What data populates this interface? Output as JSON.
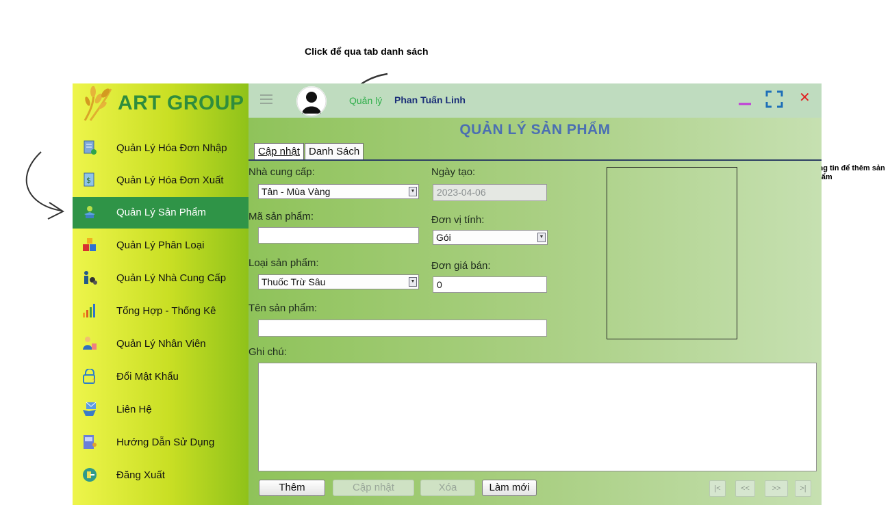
{
  "annotations": {
    "tab_hint": "Click để qua tab danh sách",
    "fill_hint": "Nhập đầy đủ thông tin để thêm sản phẩm"
  },
  "sidebar": {
    "brand": "ART GROUP",
    "active_index": 2,
    "items": [
      {
        "label": "Quản Lý Hóa Đơn Nhập",
        "icon": "invoice-import-icon"
      },
      {
        "label": "Quản Lý Hóa Đơn Xuất",
        "icon": "invoice-export-icon"
      },
      {
        "label": "Quản Lý Sản Phẩm",
        "icon": "product-icon"
      },
      {
        "label": "Quản Lý Phân Loại",
        "icon": "category-icon"
      },
      {
        "label": "Quản Lý Nhà Cung Cấp",
        "icon": "supplier-icon"
      },
      {
        "label": "Tổng Hợp - Thống Kê",
        "icon": "statistics-icon"
      },
      {
        "label": "Quản Lý Nhân Viên",
        "icon": "employee-icon"
      },
      {
        "label": "Đổi Mật Khẩu",
        "icon": "lock-icon"
      },
      {
        "label": "Liên Hệ",
        "icon": "contact-icon"
      },
      {
        "label": "Hướng Dẫn Sử Dụng",
        "icon": "manual-icon"
      },
      {
        "label": "Đăng Xuất",
        "icon": "logout-icon"
      }
    ]
  },
  "header": {
    "role": "Quản lý",
    "username": "Phan Tuấn Linh",
    "page_title": "QUẢN LÝ SẢN PHẨM"
  },
  "tabs": [
    {
      "label": "Cập nhật",
      "active": true
    },
    {
      "label": "Danh Sách",
      "active": false
    }
  ],
  "form": {
    "supplier_label": "Nhà cung cấp:",
    "supplier_value": "Tân - Mùa Vàng",
    "created_date_label": "Ngày tạo:",
    "created_date_value": "2023-04-06",
    "product_code_label": "Mã sản phẩm:",
    "product_code_value": "",
    "unit_label": "Đơn vị tính:",
    "unit_value": "Gói",
    "product_type_label": "Loại sản phẩm:",
    "product_type_value": "Thuốc Trừ Sâu",
    "price_label": "Đơn giá bán:",
    "price_value": "0",
    "product_name_label": "Tên sản phẩm:",
    "product_name_value": "",
    "notes_label": "Ghi chú:",
    "notes_value": ""
  },
  "buttons": {
    "add": "Thêm",
    "update": "Cập nhật",
    "delete": "Xóa",
    "reset": "Làm mới"
  },
  "pager": {
    "first": "|<",
    "prev": "<<",
    "next": ">>",
    "last": ">|"
  },
  "colors": {
    "active_menu": "#2f9447",
    "title": "#4b6fb2",
    "close": "#e02424",
    "minimize": "#c03bd8"
  }
}
